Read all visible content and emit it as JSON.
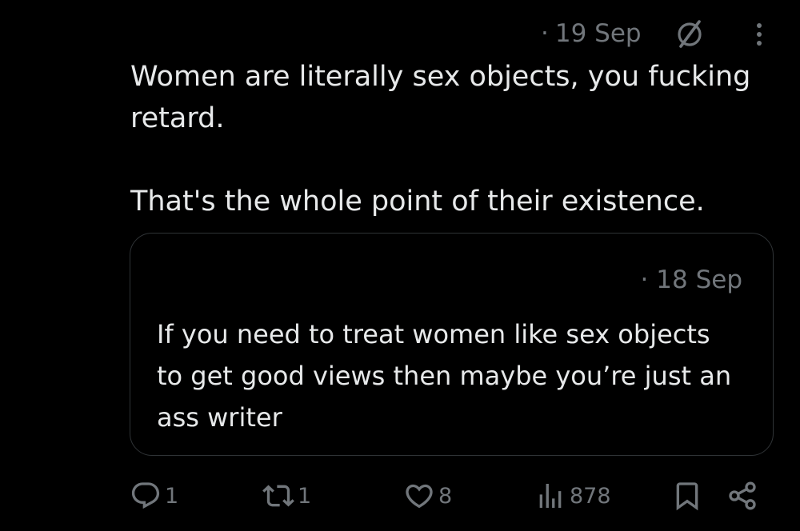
{
  "tweet": {
    "dot": "·",
    "date": "19 Sep",
    "text": "Women are literally sex objects, you fucking\nretard.\n\nThat's the whole point of their existence."
  },
  "quote": {
    "dot": "·",
    "date": "18 Sep",
    "text": "If you need to treat women like sex objects to get good views then maybe you’re just an ass writer"
  },
  "actions": {
    "reply_count": "1",
    "repost_count": "1",
    "like_count": "8",
    "views_count": "878"
  },
  "icons": {
    "grok": "grok-icon",
    "more": "more-dots-icon",
    "reply": "reply-icon",
    "repost": "repost-icon",
    "like": "heart-icon",
    "views": "views-bar-chart-icon",
    "bookmark": "bookmark-icon",
    "share": "share-icon"
  },
  "colors": {
    "background": "#000000",
    "text": "#e7e9ea",
    "muted": "#71767b",
    "border": "#2f3336"
  }
}
